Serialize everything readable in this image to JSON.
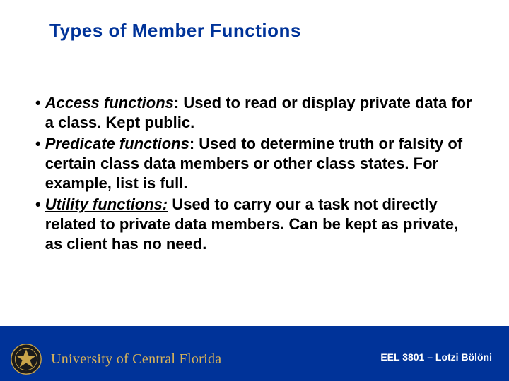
{
  "slide": {
    "title": "Types of Member Functions",
    "bullets": [
      {
        "lead": "Access functions",
        "lead_style": "italic",
        "rest": ": Used to read or display private data for a class. Kept public."
      },
      {
        "lead": "Predicate functions",
        "lead_style": "italic",
        "rest": ": Used to determine truth or falsity of certain class data members or other class states.  For example, list is full."
      },
      {
        "lead": "Utility functions:",
        "lead_style": "italic-underline",
        "rest": " Used to carry our a task not directly related to private data members. Can be kept as private, as client has no need."
      }
    ]
  },
  "footer": {
    "university": "University of Central Florida",
    "course": "EEL 3801 – Lotzi Bölöni"
  }
}
